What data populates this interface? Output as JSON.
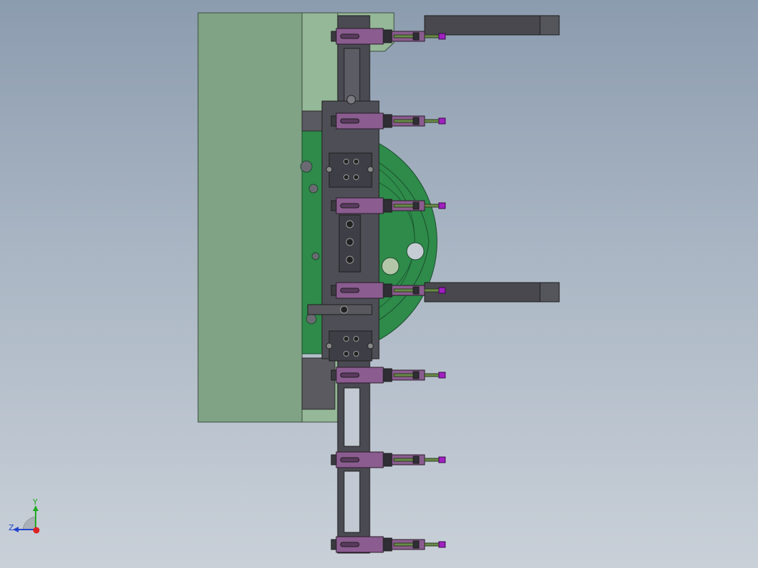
{
  "viewport": {
    "title": "",
    "colors": {
      "background_top": "#8c9caf",
      "background_bottom": "#c9d0d8",
      "housing": "#7fa384",
      "housing_light": "#95b898",
      "flange": "#2e8b4a",
      "frame": "#4a4a52",
      "clamp": "#8a5c8f",
      "pin": "#6a8a4a"
    },
    "clamps": [
      {
        "name": "clamp-1",
        "has_arm": true
      },
      {
        "name": "clamp-2",
        "has_arm": false
      },
      {
        "name": "clamp-3",
        "has_arm": false
      },
      {
        "name": "clamp-4",
        "has_arm": true
      },
      {
        "name": "clamp-5",
        "has_arm": false
      },
      {
        "name": "clamp-6",
        "has_arm": false
      },
      {
        "name": "clamp-7",
        "has_arm": false
      }
    ]
  },
  "triad": {
    "y_label": "Y",
    "z_label": "Z",
    "colors": {
      "y": "#22aa22",
      "z": "#2244cc",
      "x": "#dd2222"
    }
  }
}
